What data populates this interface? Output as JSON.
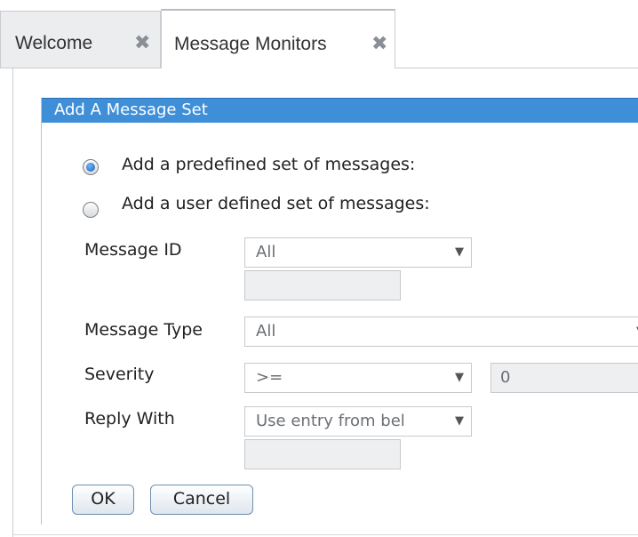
{
  "tabs": [
    {
      "label": "Welcome",
      "close_icon": "close-icon"
    },
    {
      "label": "Message Monitors",
      "close_icon": "close-icon"
    }
  ],
  "dialog": {
    "title": "Add A Message Set",
    "options": [
      {
        "label": "Add a predefined set of messages:",
        "selected": true
      },
      {
        "label": "Add a user defined set of messages:",
        "selected": false
      }
    ],
    "fields": {
      "message_id": {
        "label": "Message ID",
        "value": "All",
        "text": ""
      },
      "message_type": {
        "label": "Message Type",
        "value": "All"
      },
      "severity": {
        "label": "Severity",
        "operator": ">=",
        "value": "0"
      },
      "reply_with": {
        "label": "Reply With",
        "value": "Use entry from bel",
        "text": ""
      }
    },
    "buttons": {
      "ok": "OK",
      "cancel": "Cancel"
    }
  },
  "colors": {
    "title_bar": "#3f8fd8",
    "radio_selected": "#1f5fa8"
  },
  "glyphs": {
    "close": "✖",
    "dropdown": "▼"
  }
}
